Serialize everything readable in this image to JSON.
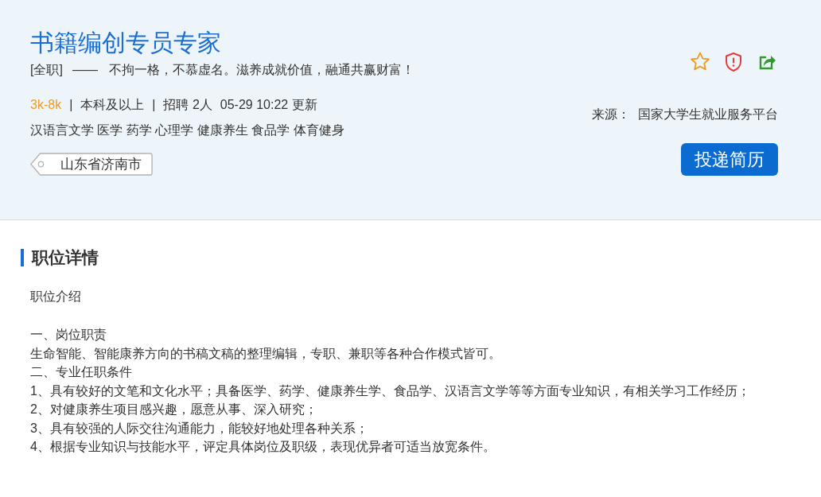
{
  "job": {
    "title": "书籍编创专员专家",
    "type": "[全职]",
    "dash": "——",
    "slogan": "不拘一格，不慕虚名。滋养成就价值，融通共赢财富！",
    "salary": "3k-8k",
    "separator": "|",
    "education": "本科及以上",
    "hiring": "招聘 2人",
    "updated": "05-29 10:22 更新",
    "majors": "汉语言文学 医学 药学 心理学 健康养生 食品学 体育健身",
    "location": "山东省济南市"
  },
  "actions": [
    {
      "kind": "favorite"
    },
    {
      "kind": "report"
    },
    {
      "kind": "share"
    }
  ],
  "source": {
    "label": "来源：",
    "value": "国家大学生就业服务平台"
  },
  "apply_button": "投递简历",
  "section": {
    "title": "职位详情",
    "intro": "职位介绍",
    "lines": [
      "一、岗位职责",
      "生命智能、智能康养方向的书稿文稿的整理编辑，专职、兼职等各种合作模式皆可。",
      "二、专业任职条件",
      "1、具有较好的文笔和文化水平；具备医学、药学、健康养生学、食品学、汉语言文学等等方面专业知识，有相关学习工作经历；",
      "2、对健康养生项目感兴趣，愿意从事、深入研究；",
      "3、具有较强的人际交往沟通能力，能较好地处理各种关系；",
      "4、根据专业知识与技能水平，评定具体岗位及职级，表现优异者可适当放宽条件。"
    ]
  }
}
